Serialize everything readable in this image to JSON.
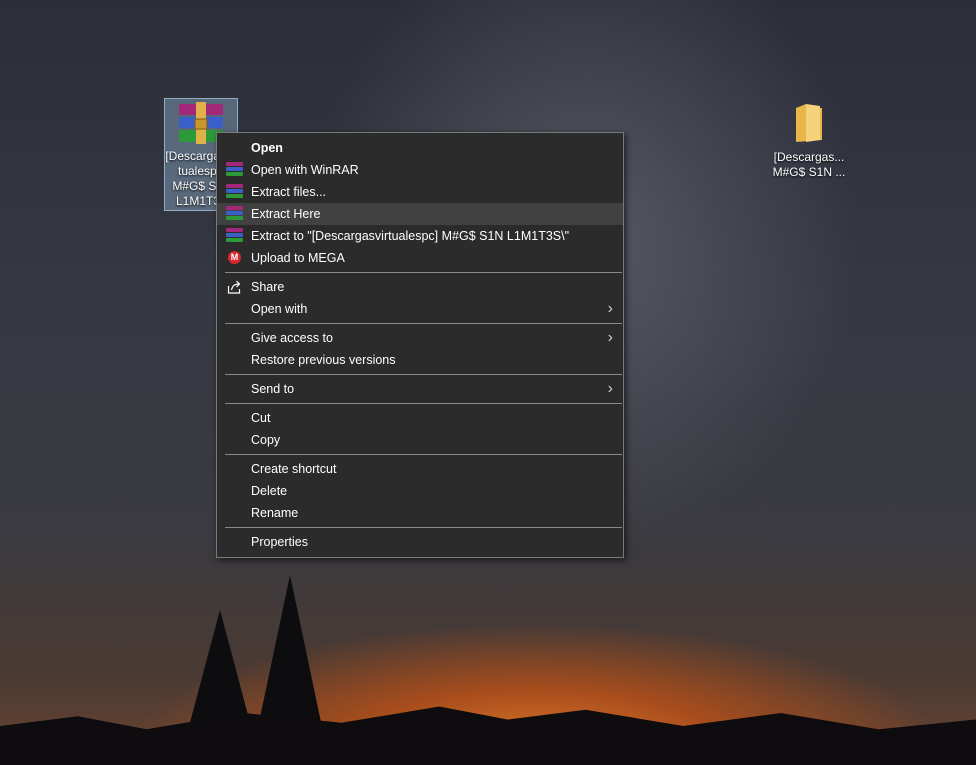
{
  "desktop": {
    "rar_file": {
      "icon": "winrar-archive-icon",
      "label_lines": [
        "[Descargasvir",
        "tualespc]",
        "M#G$ S1N",
        "L1M1T3S"
      ]
    },
    "folder": {
      "icon": "folder-icon",
      "label_lines": [
        "[Descargas...",
        "M#G$ S1N ..."
      ]
    }
  },
  "context_menu": {
    "items": [
      {
        "label": "Open",
        "icon": ""
      },
      {
        "label": "Open with WinRAR",
        "icon": "winrar-icon"
      },
      {
        "label": "Extract files...",
        "icon": "winrar-icon"
      },
      {
        "label": "Extract Here",
        "icon": "winrar-icon"
      },
      {
        "label": "Extract to \"[Descargasvirtualespc] M#G$ S1N L1M1T3S\\\"",
        "icon": "winrar-icon"
      },
      {
        "label": "Upload to MEGA",
        "icon": "mega-icon"
      },
      {
        "label": "Share",
        "icon": "share-icon"
      },
      {
        "label": "Open with",
        "icon": ""
      },
      {
        "label": "Give access to",
        "icon": ""
      },
      {
        "label": "Restore previous versions",
        "icon": ""
      },
      {
        "label": "Send to",
        "icon": ""
      },
      {
        "label": "Cut",
        "icon": ""
      },
      {
        "label": "Copy",
        "icon": ""
      },
      {
        "label": "Create shortcut",
        "icon": ""
      },
      {
        "label": "Delete",
        "icon": ""
      },
      {
        "label": "Rename",
        "icon": ""
      },
      {
        "label": "Properties",
        "icon": ""
      }
    ],
    "highlighted_item": "Extract Here",
    "mega_letter": "M",
    "submenu_arrow": "›"
  },
  "colors": {
    "menu_bg": "#2b2b2b",
    "menu_highlight": "#414141",
    "mega_red": "#d9272e"
  }
}
